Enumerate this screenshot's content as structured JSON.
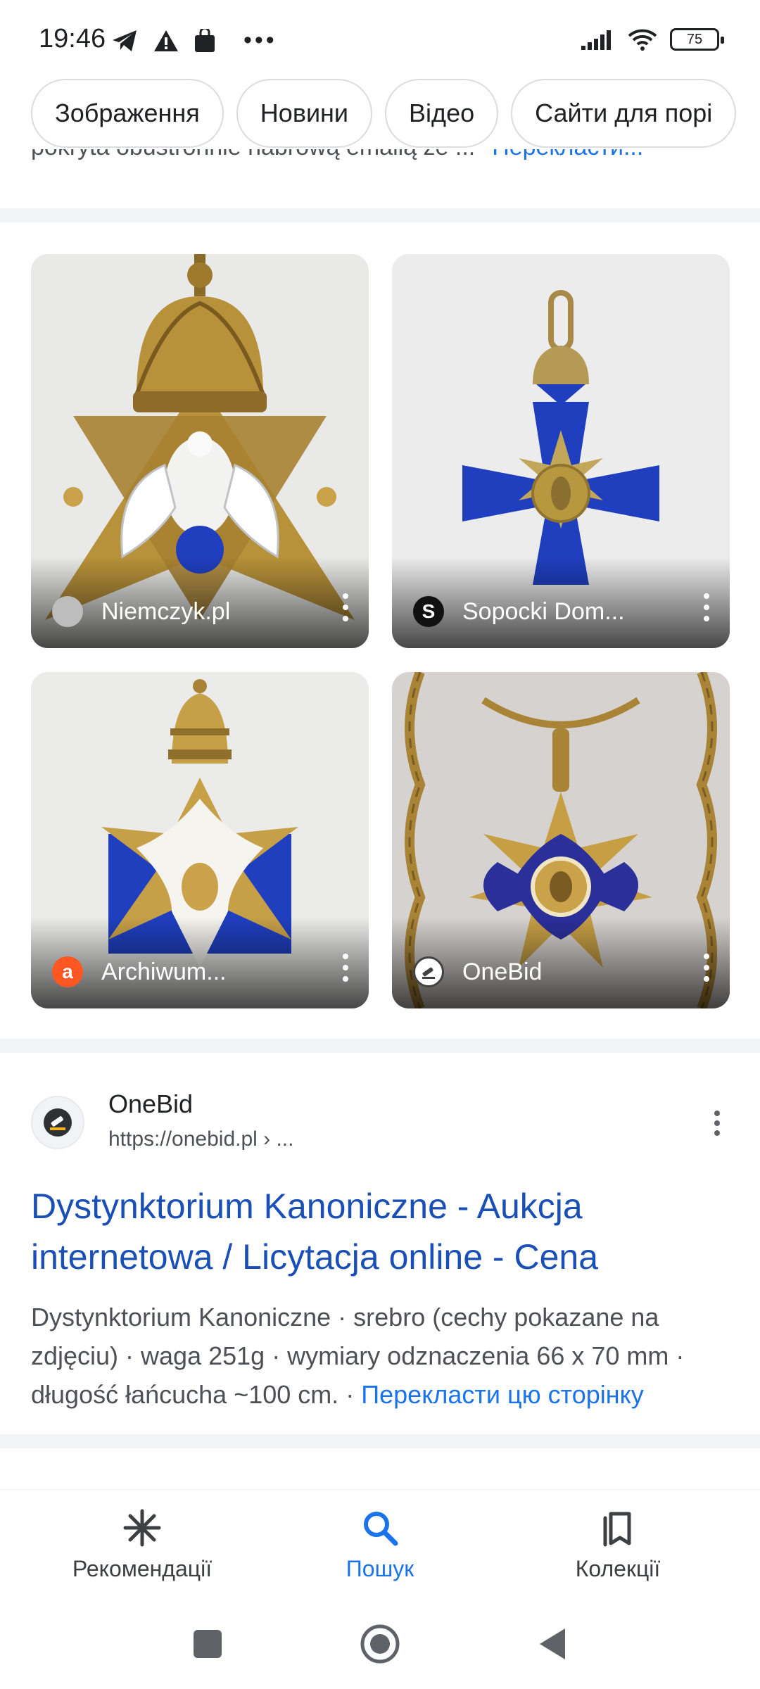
{
  "status_bar": {
    "time": "19:46",
    "battery": "75"
  },
  "chips": [
    {
      "label": "Зображення"
    },
    {
      "label": "Новини"
    },
    {
      "label": "Відео"
    },
    {
      "label": "Сайти для порі"
    }
  ],
  "previous_result": {
    "snippet": "pokryta obustronnie nabrową emalią ze ...",
    "translate": "Перекласти..."
  },
  "images": [
    {
      "source": "Niemczyk.pl",
      "favicon_color": "#bdbdbd"
    },
    {
      "source": "Sopocki Dom...",
      "favicon_letter": "S",
      "favicon_color": "#111111"
    },
    {
      "source": "Archiwum...",
      "favicon_letter": "a",
      "favicon_color": "#ff5722"
    },
    {
      "source": "OneBid",
      "favicon_color": "#424242"
    }
  ],
  "result": {
    "site_name": "OneBid",
    "url": "https://onebid.pl › ...",
    "title": "Dystynktorium Kanoniczne - Aukcja internetowa / Licytacja online - Cena",
    "snippet": "Dystynktorium Kanoniczne · srebro (cechy pokazane na zdjęciu) · waga 251g · wymiary odznaczenia 66 x 70 mm · długość łańcucha ~100 cm. · ",
    "translate": "Перекласти цю сторінку"
  },
  "bottom_nav": {
    "items": [
      {
        "label": "Рекомендації",
        "icon": "asterisk-icon"
      },
      {
        "label": "Пошук",
        "icon": "search-icon",
        "active": true
      },
      {
        "label": "Колекції",
        "icon": "collections-icon"
      }
    ]
  },
  "colors": {
    "link": "#1a4fb5",
    "accent": "#1a73e8",
    "enamel_blue": "#1f3fbf",
    "gold": "#b8923a"
  }
}
